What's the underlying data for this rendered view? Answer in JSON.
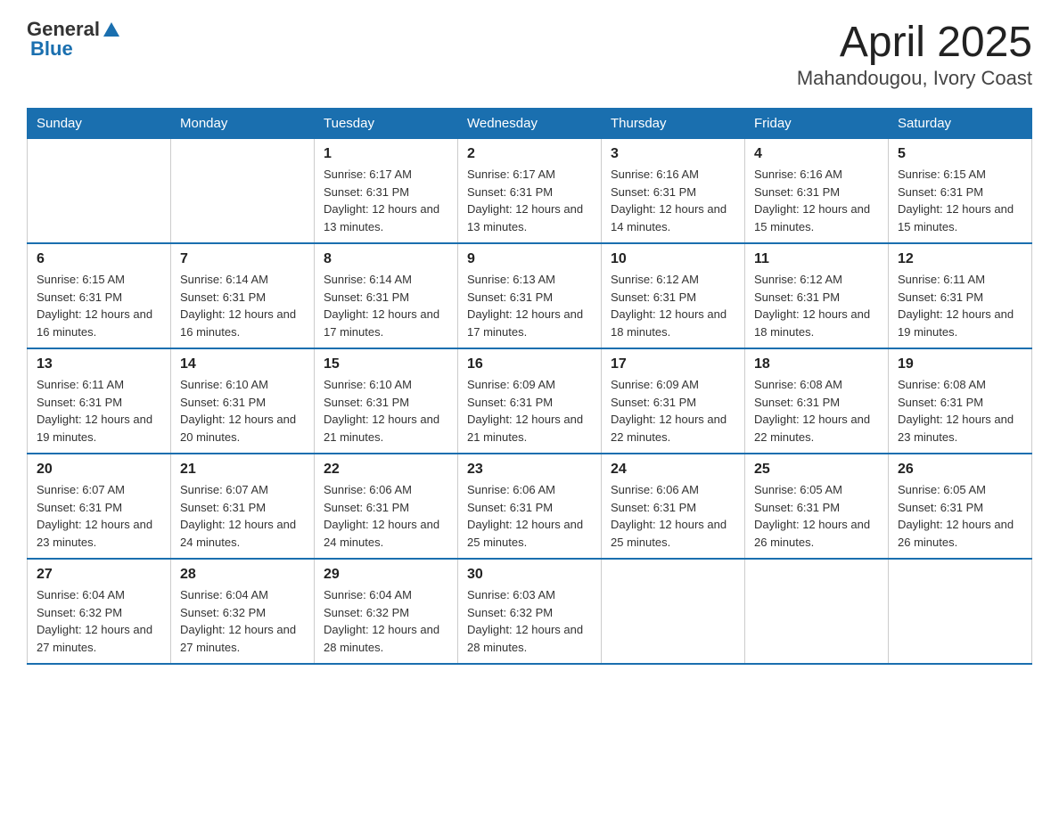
{
  "header": {
    "logo_general": "General",
    "logo_blue": "Blue",
    "title": "April 2025",
    "subtitle": "Mahandougou, Ivory Coast"
  },
  "days_of_week": [
    "Sunday",
    "Monday",
    "Tuesday",
    "Wednesday",
    "Thursday",
    "Friday",
    "Saturday"
  ],
  "weeks": [
    [
      {
        "day": "",
        "sunrise": "",
        "sunset": "",
        "daylight": ""
      },
      {
        "day": "",
        "sunrise": "",
        "sunset": "",
        "daylight": ""
      },
      {
        "day": "1",
        "sunrise": "Sunrise: 6:17 AM",
        "sunset": "Sunset: 6:31 PM",
        "daylight": "Daylight: 12 hours and 13 minutes."
      },
      {
        "day": "2",
        "sunrise": "Sunrise: 6:17 AM",
        "sunset": "Sunset: 6:31 PM",
        "daylight": "Daylight: 12 hours and 13 minutes."
      },
      {
        "day": "3",
        "sunrise": "Sunrise: 6:16 AM",
        "sunset": "Sunset: 6:31 PM",
        "daylight": "Daylight: 12 hours and 14 minutes."
      },
      {
        "day": "4",
        "sunrise": "Sunrise: 6:16 AM",
        "sunset": "Sunset: 6:31 PM",
        "daylight": "Daylight: 12 hours and 15 minutes."
      },
      {
        "day": "5",
        "sunrise": "Sunrise: 6:15 AM",
        "sunset": "Sunset: 6:31 PM",
        "daylight": "Daylight: 12 hours and 15 minutes."
      }
    ],
    [
      {
        "day": "6",
        "sunrise": "Sunrise: 6:15 AM",
        "sunset": "Sunset: 6:31 PM",
        "daylight": "Daylight: 12 hours and 16 minutes."
      },
      {
        "day": "7",
        "sunrise": "Sunrise: 6:14 AM",
        "sunset": "Sunset: 6:31 PM",
        "daylight": "Daylight: 12 hours and 16 minutes."
      },
      {
        "day": "8",
        "sunrise": "Sunrise: 6:14 AM",
        "sunset": "Sunset: 6:31 PM",
        "daylight": "Daylight: 12 hours and 17 minutes."
      },
      {
        "day": "9",
        "sunrise": "Sunrise: 6:13 AM",
        "sunset": "Sunset: 6:31 PM",
        "daylight": "Daylight: 12 hours and 17 minutes."
      },
      {
        "day": "10",
        "sunrise": "Sunrise: 6:12 AM",
        "sunset": "Sunset: 6:31 PM",
        "daylight": "Daylight: 12 hours and 18 minutes."
      },
      {
        "day": "11",
        "sunrise": "Sunrise: 6:12 AM",
        "sunset": "Sunset: 6:31 PM",
        "daylight": "Daylight: 12 hours and 18 minutes."
      },
      {
        "day": "12",
        "sunrise": "Sunrise: 6:11 AM",
        "sunset": "Sunset: 6:31 PM",
        "daylight": "Daylight: 12 hours and 19 minutes."
      }
    ],
    [
      {
        "day": "13",
        "sunrise": "Sunrise: 6:11 AM",
        "sunset": "Sunset: 6:31 PM",
        "daylight": "Daylight: 12 hours and 19 minutes."
      },
      {
        "day": "14",
        "sunrise": "Sunrise: 6:10 AM",
        "sunset": "Sunset: 6:31 PM",
        "daylight": "Daylight: 12 hours and 20 minutes."
      },
      {
        "day": "15",
        "sunrise": "Sunrise: 6:10 AM",
        "sunset": "Sunset: 6:31 PM",
        "daylight": "Daylight: 12 hours and 21 minutes."
      },
      {
        "day": "16",
        "sunrise": "Sunrise: 6:09 AM",
        "sunset": "Sunset: 6:31 PM",
        "daylight": "Daylight: 12 hours and 21 minutes."
      },
      {
        "day": "17",
        "sunrise": "Sunrise: 6:09 AM",
        "sunset": "Sunset: 6:31 PM",
        "daylight": "Daylight: 12 hours and 22 minutes."
      },
      {
        "day": "18",
        "sunrise": "Sunrise: 6:08 AM",
        "sunset": "Sunset: 6:31 PM",
        "daylight": "Daylight: 12 hours and 22 minutes."
      },
      {
        "day": "19",
        "sunrise": "Sunrise: 6:08 AM",
        "sunset": "Sunset: 6:31 PM",
        "daylight": "Daylight: 12 hours and 23 minutes."
      }
    ],
    [
      {
        "day": "20",
        "sunrise": "Sunrise: 6:07 AM",
        "sunset": "Sunset: 6:31 PM",
        "daylight": "Daylight: 12 hours and 23 minutes."
      },
      {
        "day": "21",
        "sunrise": "Sunrise: 6:07 AM",
        "sunset": "Sunset: 6:31 PM",
        "daylight": "Daylight: 12 hours and 24 minutes."
      },
      {
        "day": "22",
        "sunrise": "Sunrise: 6:06 AM",
        "sunset": "Sunset: 6:31 PM",
        "daylight": "Daylight: 12 hours and 24 minutes."
      },
      {
        "day": "23",
        "sunrise": "Sunrise: 6:06 AM",
        "sunset": "Sunset: 6:31 PM",
        "daylight": "Daylight: 12 hours and 25 minutes."
      },
      {
        "day": "24",
        "sunrise": "Sunrise: 6:06 AM",
        "sunset": "Sunset: 6:31 PM",
        "daylight": "Daylight: 12 hours and 25 minutes."
      },
      {
        "day": "25",
        "sunrise": "Sunrise: 6:05 AM",
        "sunset": "Sunset: 6:31 PM",
        "daylight": "Daylight: 12 hours and 26 minutes."
      },
      {
        "day": "26",
        "sunrise": "Sunrise: 6:05 AM",
        "sunset": "Sunset: 6:31 PM",
        "daylight": "Daylight: 12 hours and 26 minutes."
      }
    ],
    [
      {
        "day": "27",
        "sunrise": "Sunrise: 6:04 AM",
        "sunset": "Sunset: 6:32 PM",
        "daylight": "Daylight: 12 hours and 27 minutes."
      },
      {
        "day": "28",
        "sunrise": "Sunrise: 6:04 AM",
        "sunset": "Sunset: 6:32 PM",
        "daylight": "Daylight: 12 hours and 27 minutes."
      },
      {
        "day": "29",
        "sunrise": "Sunrise: 6:04 AM",
        "sunset": "Sunset: 6:32 PM",
        "daylight": "Daylight: 12 hours and 28 minutes."
      },
      {
        "day": "30",
        "sunrise": "Sunrise: 6:03 AM",
        "sunset": "Sunset: 6:32 PM",
        "daylight": "Daylight: 12 hours and 28 minutes."
      },
      {
        "day": "",
        "sunrise": "",
        "sunset": "",
        "daylight": ""
      },
      {
        "day": "",
        "sunrise": "",
        "sunset": "",
        "daylight": ""
      },
      {
        "day": "",
        "sunrise": "",
        "sunset": "",
        "daylight": ""
      }
    ]
  ]
}
